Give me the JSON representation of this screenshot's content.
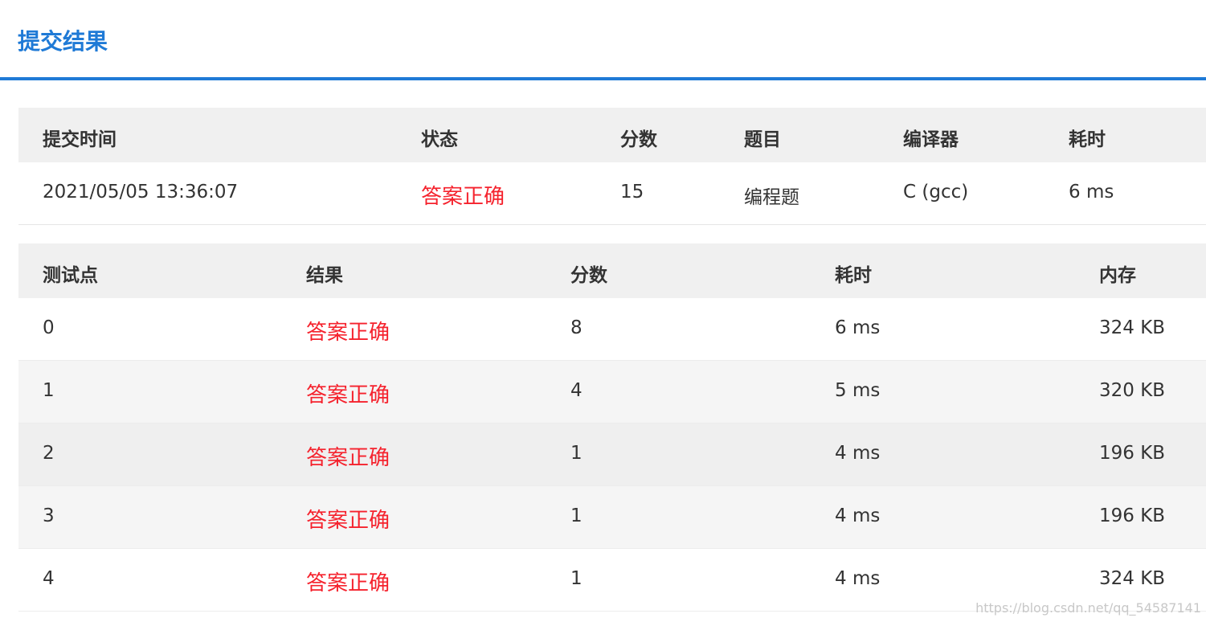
{
  "header": {
    "title": "提交结果"
  },
  "summary": {
    "columns": [
      "提交时间",
      "状态",
      "分数",
      "题目",
      "编译器",
      "耗时"
    ],
    "row": {
      "time": "2021/05/05 13:36:07",
      "status": "答案正确",
      "score": "15",
      "problem": "编程题",
      "compiler": "C (gcc)",
      "elapsed": "6 ms"
    }
  },
  "cases": {
    "columns": [
      "测试点",
      "结果",
      "分数",
      "耗时",
      "内存"
    ],
    "rows": [
      {
        "id": "0",
        "result": "答案正确",
        "score": "8",
        "time": "6 ms",
        "memory": "324 KB"
      },
      {
        "id": "1",
        "result": "答案正确",
        "score": "4",
        "time": "5 ms",
        "memory": "320 KB"
      },
      {
        "id": "2",
        "result": "答案正确",
        "score": "1",
        "time": "4 ms",
        "memory": "196 KB"
      },
      {
        "id": "3",
        "result": "答案正确",
        "score": "1",
        "time": "4 ms",
        "memory": "196 KB"
      },
      {
        "id": "4",
        "result": "答案正确",
        "score": "1",
        "time": "4 ms",
        "memory": "324 KB"
      }
    ]
  },
  "watermark": "https://blog.csdn.net/qq_54587141",
  "colors": {
    "accent": "#1f7ad6",
    "success_text": "#f5222d"
  }
}
